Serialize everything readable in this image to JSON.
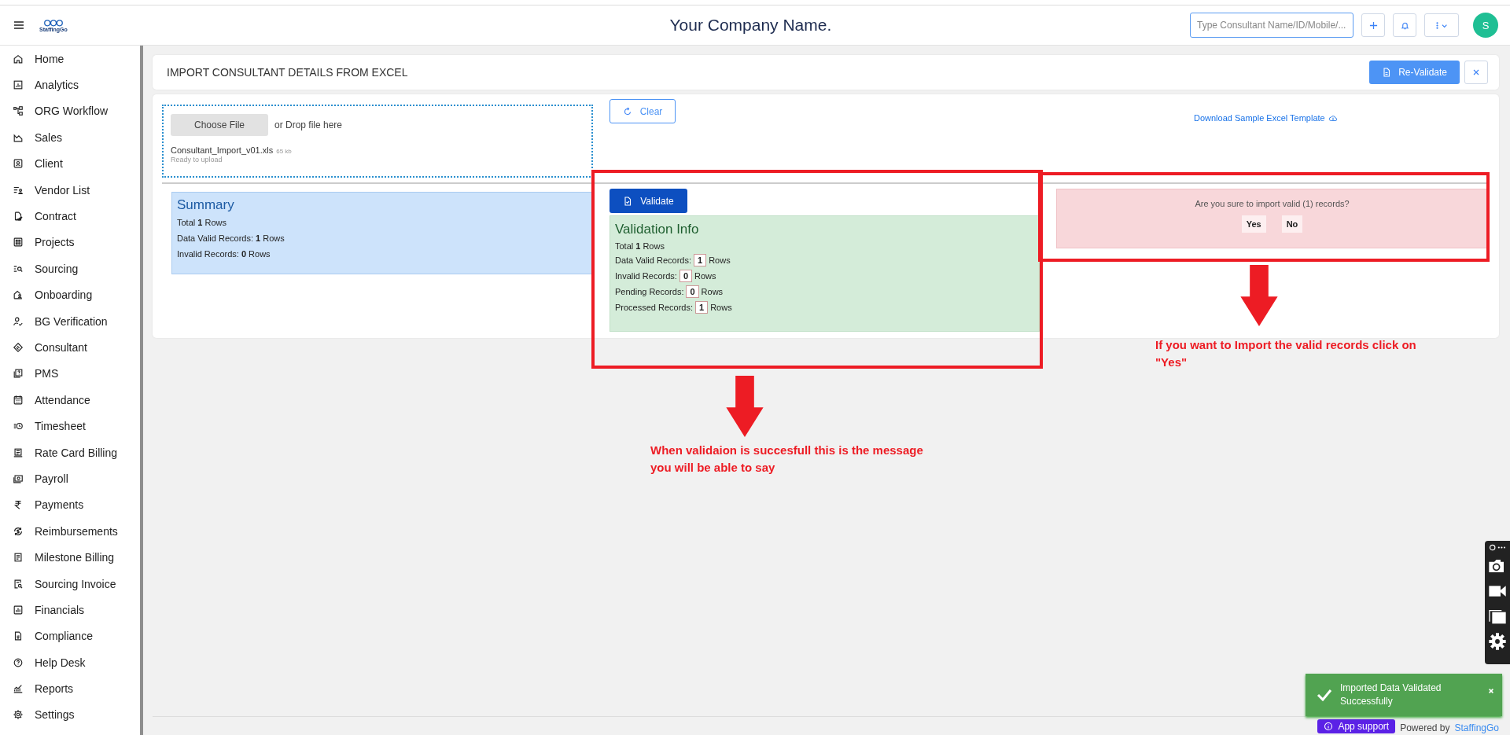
{
  "header": {
    "logo_text": "StaffingGo",
    "company_name": "Your Company Name.",
    "search": {
      "placeholder": "Type Consultant Name/ID/Mobile/..."
    },
    "avatar": "S"
  },
  "sidebar": {
    "items": [
      {
        "label": "Home"
      },
      {
        "label": "Analytics"
      },
      {
        "label": "ORG Workflow"
      },
      {
        "label": "Sales"
      },
      {
        "label": "Client"
      },
      {
        "label": "Vendor List"
      },
      {
        "label": "Contract"
      },
      {
        "label": "Projects"
      },
      {
        "label": "Sourcing"
      },
      {
        "label": "Onboarding"
      },
      {
        "label": "BG Verification"
      },
      {
        "label": "Consultant"
      },
      {
        "label": "PMS"
      },
      {
        "label": "Attendance"
      },
      {
        "label": "Timesheet"
      },
      {
        "label": "Rate Card Billing"
      },
      {
        "label": "Payroll"
      },
      {
        "label": "Payments"
      },
      {
        "label": "Reimbursements"
      },
      {
        "label": "Milestone Billing"
      },
      {
        "label": "Sourcing Invoice"
      },
      {
        "label": "Financials"
      },
      {
        "label": "Compliance"
      },
      {
        "label": "Help Desk"
      },
      {
        "label": "Reports"
      },
      {
        "label": "Settings"
      }
    ]
  },
  "page_title": "IMPORT CONSULTANT DETAILS FROM EXCEL",
  "revalidate_button": "Re-Validate",
  "dropzone": {
    "button": "Choose File",
    "hint": "or Drop file here",
    "file_name": "Consultant_Import_v01.xls",
    "file_size": "65 kb",
    "status": "Ready to upload"
  },
  "clear_button": "Clear",
  "download_link": "Download Sample Excel Template",
  "summary": {
    "title": "Summary",
    "lines": [
      "Total **1** Rows",
      "Data Valid Records: **1** Rows",
      "Invalid Records: **0** Rows"
    ]
  },
  "validate_button": "Validate",
  "validation_info": {
    "title": "Validation Info",
    "lines": [
      {
        "kind": "text",
        "text": "Total **1** Rows"
      },
      {
        "kind": "boxed",
        "label": "Data Valid Records:",
        "value": "1",
        "suffix": "Rows"
      },
      {
        "kind": "boxed",
        "label": "Invalid Records:",
        "value": "0",
        "suffix": "Rows"
      },
      {
        "kind": "boxed",
        "label": "Pending Records:",
        "value": "0",
        "suffix": "Rows"
      },
      {
        "kind": "boxed",
        "label": "Processed Records:",
        "value": "1",
        "suffix": "Rows"
      }
    ]
  },
  "confirm": {
    "question": "Are you sure to import valid (1) records?",
    "buttons": [
      "Yes",
      "No"
    ]
  },
  "annotations": [
    {
      "text": "If you want to Import the valid records click on \"Yes\""
    },
    {
      "text": "When validaion is succesfull this is the message you will be able to say"
    }
  ],
  "footer": {
    "app_support": "App support",
    "powered_by": "Powered by",
    "brand": "StaffingGo"
  },
  "toast": {
    "message": "Imported Data Validated Successfully"
  }
}
